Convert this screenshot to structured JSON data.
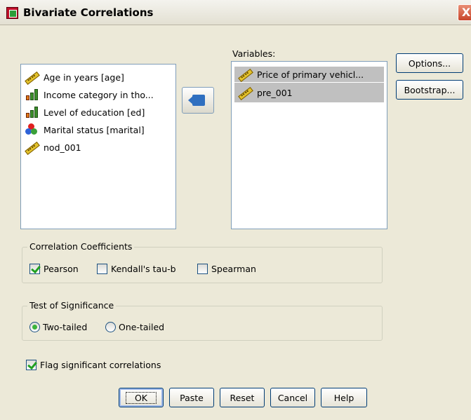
{
  "window": {
    "title": "Bivariate Correlations",
    "close_glyph": "X"
  },
  "source_list": {
    "items": [
      {
        "label": "Age in years [age]",
        "icon": "scale-ruler-icon"
      },
      {
        "label": "Income category in tho...",
        "icon": "ordinal-bars-icon"
      },
      {
        "label": "Level of education [ed]",
        "icon": "ordinal-bars-icon"
      },
      {
        "label": "Marital status [marital]",
        "icon": "nominal-circles-icon"
      },
      {
        "label": "nod_001",
        "icon": "scale-ruler-icon"
      }
    ]
  },
  "variables": {
    "label": "Variables:",
    "items": [
      {
        "label": "Price of primary vehicl...",
        "icon": "scale-ruler-icon"
      },
      {
        "label": "pre_001",
        "icon": "scale-ruler-icon"
      }
    ]
  },
  "side_buttons": {
    "options": "Options...",
    "bootstrap": "Bootstrap..."
  },
  "correlation": {
    "legend": "Correlation Coefficients",
    "pearson": {
      "label": "Pearson",
      "checked": true
    },
    "kendall": {
      "label": "Kendall's tau-b",
      "checked": false
    },
    "spearman": {
      "label": "Spearman",
      "checked": false
    }
  },
  "significance": {
    "legend": "Test of Significance",
    "two_tailed": {
      "label": "Two-tailed",
      "selected": true
    },
    "one_tailed": {
      "label": "One-tailed",
      "selected": false
    }
  },
  "flag": {
    "label": "Flag significant correlations",
    "checked": true
  },
  "buttons": {
    "ok": "OK",
    "paste": "Paste",
    "reset": "Reset",
    "cancel": "Cancel",
    "help": "Help"
  },
  "colors": {
    "dialog_bg": "#ece9d8",
    "selection": "#c0c0c0",
    "accent_blue": "#2f6fc0",
    "check_green": "#21a121"
  }
}
